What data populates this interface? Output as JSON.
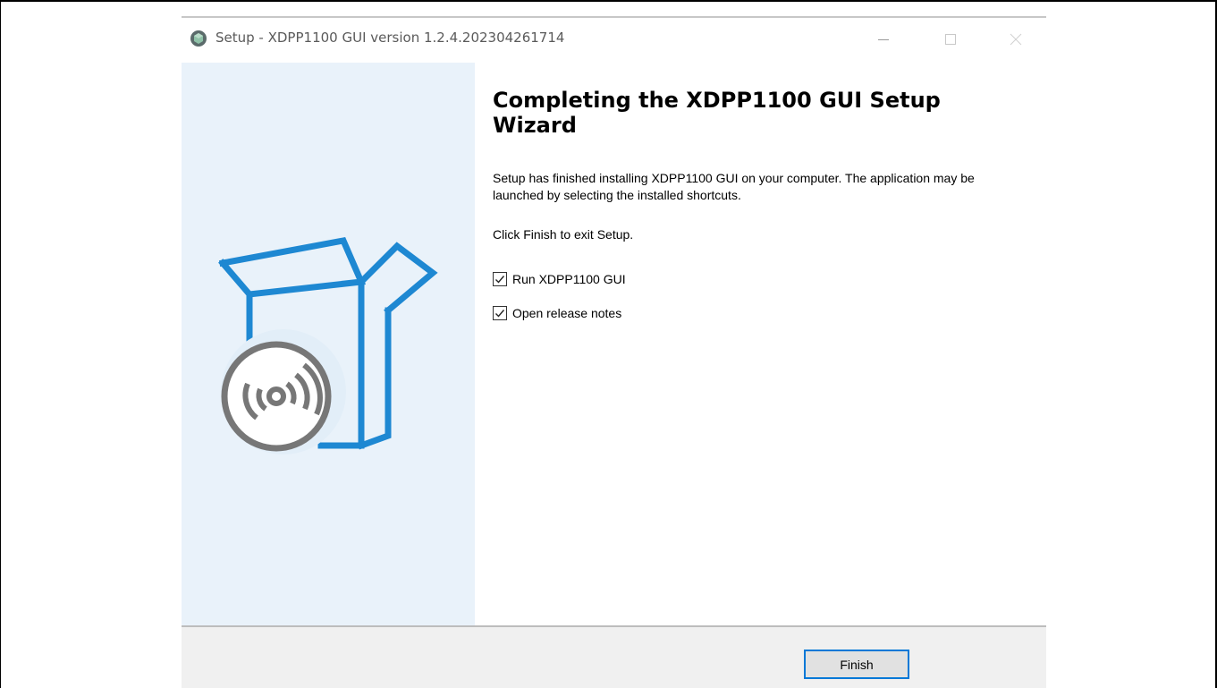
{
  "window": {
    "title": "Setup - XDPP1100 GUI version 1.2.4.202304261714",
    "controls": {
      "minimize_icon": "minimize-icon",
      "maximize_icon": "maximize-icon",
      "close_icon": "close-icon"
    }
  },
  "wizard": {
    "heading": "Completing the XDPP1100 GUI Setup Wizard",
    "paragraph_1": "Setup has finished installing XDPP1100 GUI on your computer. The application may be launched by selecting the installed shortcuts.",
    "paragraph_2": "Click Finish to exit Setup.",
    "options": [
      {
        "label": "Run XDPP1100 GUI",
        "checked": true
      },
      {
        "label": "Open release notes",
        "checked": true
      }
    ]
  },
  "footer": {
    "finish_label": "Finish"
  },
  "icons": {
    "app": "installer-app-icon",
    "artwork": "software-box-disc-icon"
  },
  "colors": {
    "sidebar_bg": "#e9f2fa",
    "box_blue": "#1e88d2",
    "disc_gray": "#777777",
    "footer_bg": "#f0f0f0",
    "button_border": "#0078d7"
  }
}
